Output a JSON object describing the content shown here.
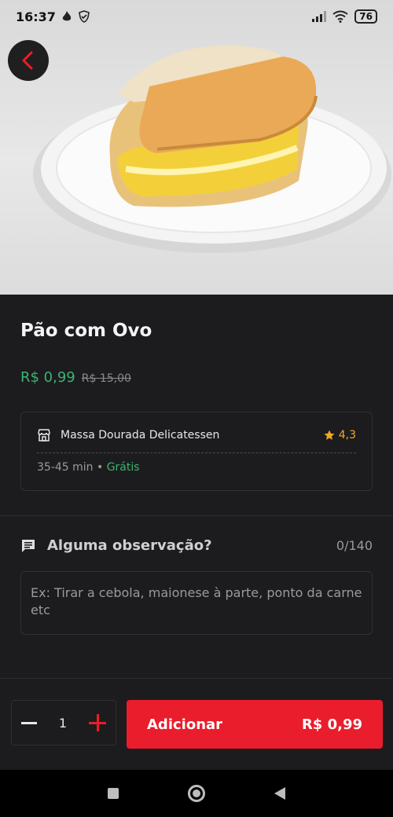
{
  "status_bar": {
    "time": "16:37",
    "battery": "76"
  },
  "product": {
    "name": "Pão com Ovo",
    "price": "R$ 0,99",
    "old_price": "R$ 15,00"
  },
  "store": {
    "name": "Massa Dourada Delicatessen",
    "rating": "4,3",
    "delivery_time": "35-45 min",
    "separator": "•",
    "delivery_fee": "Grátis"
  },
  "observation": {
    "label": "Alguma observação?",
    "counter": "0/140",
    "placeholder": "Ex: Tirar a cebola, maionese à parte, ponto da carne etc"
  },
  "footer": {
    "quantity": "1",
    "add_label": "Adicionar",
    "add_price": "R$ 0,99"
  },
  "colors": {
    "accent": "#ea1d2c",
    "price_green": "#3cb371",
    "star": "#f5a623",
    "background": "#1c1c1e"
  },
  "icons": [
    "back-icon",
    "flame-icon",
    "shield-icon",
    "signal-icon",
    "wifi-icon",
    "battery-icon",
    "store-icon",
    "star-icon",
    "comment-icon",
    "minus-icon",
    "plus-icon",
    "nav-recents-icon",
    "nav-home-icon",
    "nav-back-icon"
  ]
}
